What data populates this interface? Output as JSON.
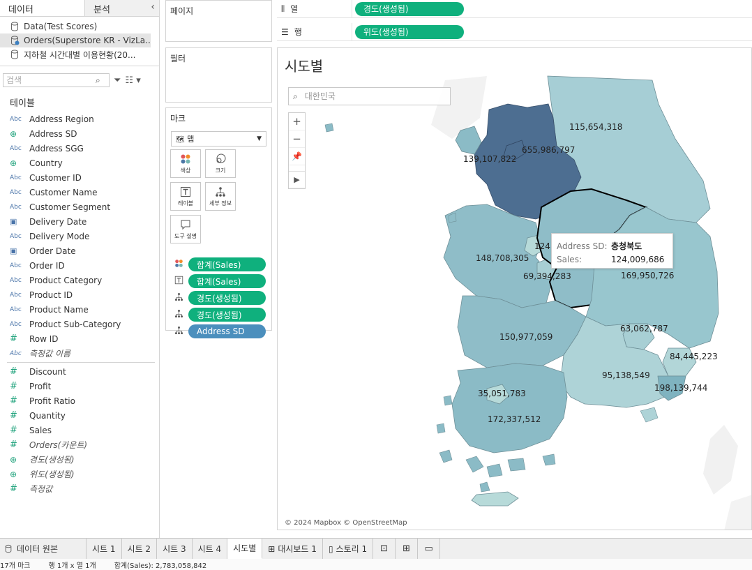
{
  "data_pane": {
    "tabs": [
      "데이터",
      "분석"
    ],
    "datasources": [
      "Data(Test Scores)",
      "Orders(Superstore KR - VizLa...",
      "지하철 시간대별 이용현황(20..."
    ],
    "search_placeholder": "검색",
    "tables_heading": "테이블",
    "dimensions": [
      {
        "type": "Abc",
        "name": "Address Region"
      },
      {
        "type": "geo",
        "name": "Address SD"
      },
      {
        "type": "Abc",
        "name": "Address SGG"
      },
      {
        "type": "geo",
        "name": "Country"
      },
      {
        "type": "Abc",
        "name": "Customer ID"
      },
      {
        "type": "Abc",
        "name": "Customer Name"
      },
      {
        "type": "Abc",
        "name": "Customer Segment"
      },
      {
        "type": "date",
        "name": "Delivery Date"
      },
      {
        "type": "Abc",
        "name": "Delivery Mode"
      },
      {
        "type": "date",
        "name": "Order Date"
      },
      {
        "type": "Abc",
        "name": "Order ID"
      },
      {
        "type": "Abc",
        "name": "Product Category"
      },
      {
        "type": "Abc",
        "name": "Product ID"
      },
      {
        "type": "Abc",
        "name": "Product Name"
      },
      {
        "type": "Abc",
        "name": "Product Sub-Category"
      },
      {
        "type": "measure",
        "name": "Row ID"
      },
      {
        "type": "Abc",
        "name": "측정값 이름",
        "italic": true
      }
    ],
    "measures": [
      {
        "type": "measure",
        "name": "Discount"
      },
      {
        "type": "measure",
        "name": "Profit"
      },
      {
        "type": "measure",
        "name": "Profit Ratio"
      },
      {
        "type": "measure",
        "name": "Quantity"
      },
      {
        "type": "measure",
        "name": "Sales"
      },
      {
        "type": "measure",
        "name": "Orders(카운트)",
        "italic": true
      },
      {
        "type": "geo",
        "name": "경도(생성됨)",
        "italic": true
      },
      {
        "type": "geo",
        "name": "위도(생성됨)",
        "italic": true
      },
      {
        "type": "measure",
        "name": "측정값",
        "italic": true
      }
    ]
  },
  "cards": {
    "pages": "페이지",
    "filters": "필터",
    "marks": "마크",
    "mark_type": "맵",
    "mark_buttons": [
      "색상",
      "크기",
      "레이블",
      "세부 정보",
      "도구 설명"
    ],
    "mark_pills": [
      "합계(Sales)",
      "합계(Sales)",
      "경도(생성됨)",
      "경도(생성됨)",
      "Address SD"
    ]
  },
  "shelves": {
    "columns_label": "열",
    "columns_pill": "경도(생성됨)",
    "rows_label": "행",
    "rows_pill": "위도(생성됨)"
  },
  "viz": {
    "title": "시도별",
    "map_search_placeholder": "대한민국",
    "attribution": "© 2024 Mapbox © OpenStreetMap",
    "tooltip": {
      "key1": "Address SD:",
      "val1": "충청북도",
      "key2": "Sales:",
      "val2": "124,009,686"
    },
    "region_labels": [
      "115,654,318",
      "655,986,797",
      "139,107,822",
      "148,708,305",
      "124",
      "69,394,283",
      "169,950,726",
      "150,977,059",
      "63,062,787",
      "84,445,223",
      "95,138,549",
      "198,139,744",
      "35,051,783",
      "172,337,512"
    ],
    "colors": {
      "dark": "#4d6e91",
      "mid": "#7ab0bf",
      "light": "#9fcad2",
      "pale": "#b7dad9"
    }
  },
  "sheet_tabs": [
    "데이터 원본",
    "시트 1",
    "시트 2",
    "시트 3",
    "시트 4",
    "시도별",
    "대시보드 1",
    "스토리 1"
  ],
  "status": {
    "marks": "17개 마크",
    "rows_cols": "행 1개 x 열 1개",
    "sum": "합계(Sales): 2,783,058,842"
  }
}
